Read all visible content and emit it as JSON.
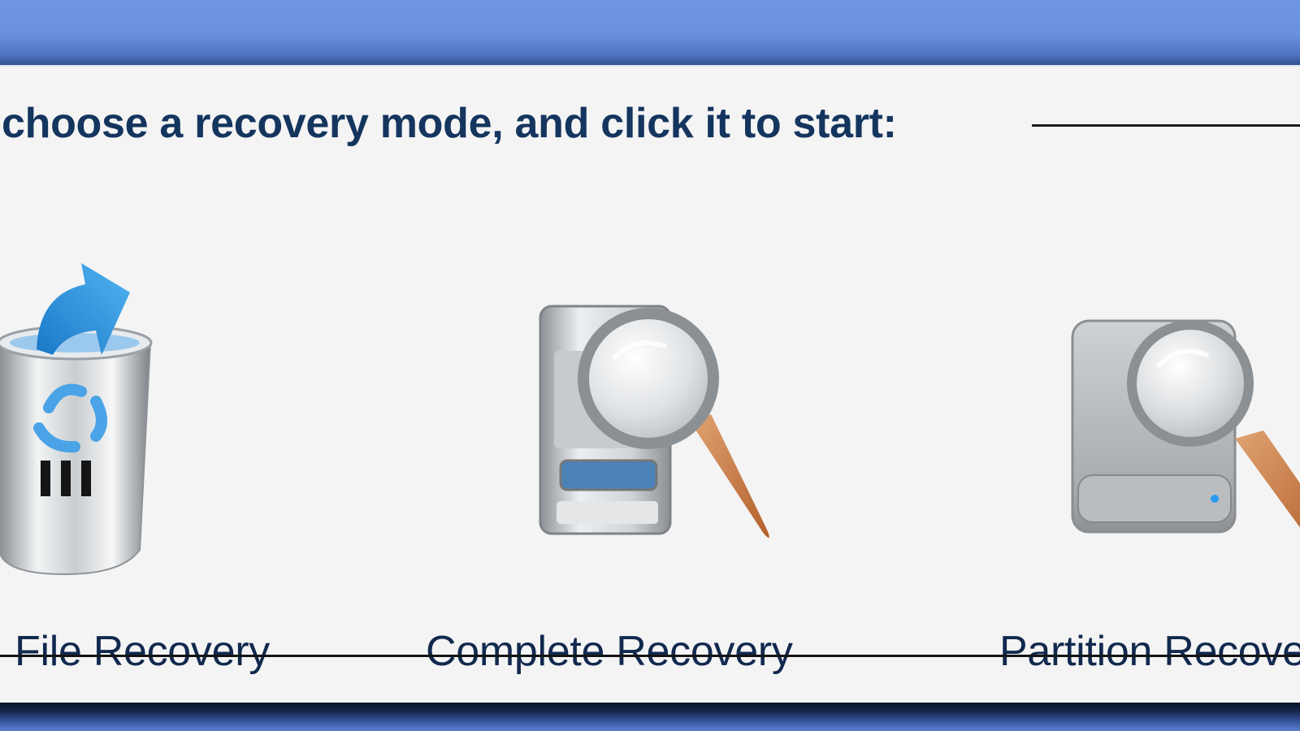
{
  "instruction": "choose a recovery mode, and click it to start:",
  "modes": [
    {
      "label": "File Recovery",
      "icon": "recycle-bin-icon"
    },
    {
      "label": "Complete Recovery",
      "icon": "drive-magnifier-icon"
    },
    {
      "label": "Partition Recovery",
      "icon": "hard-disk-magnifier-icon"
    }
  ],
  "colors": {
    "title_bar": "#6a8fde",
    "panel": "#f4f4f4",
    "heading_text": "#14355e",
    "label_text": "#12294e"
  }
}
